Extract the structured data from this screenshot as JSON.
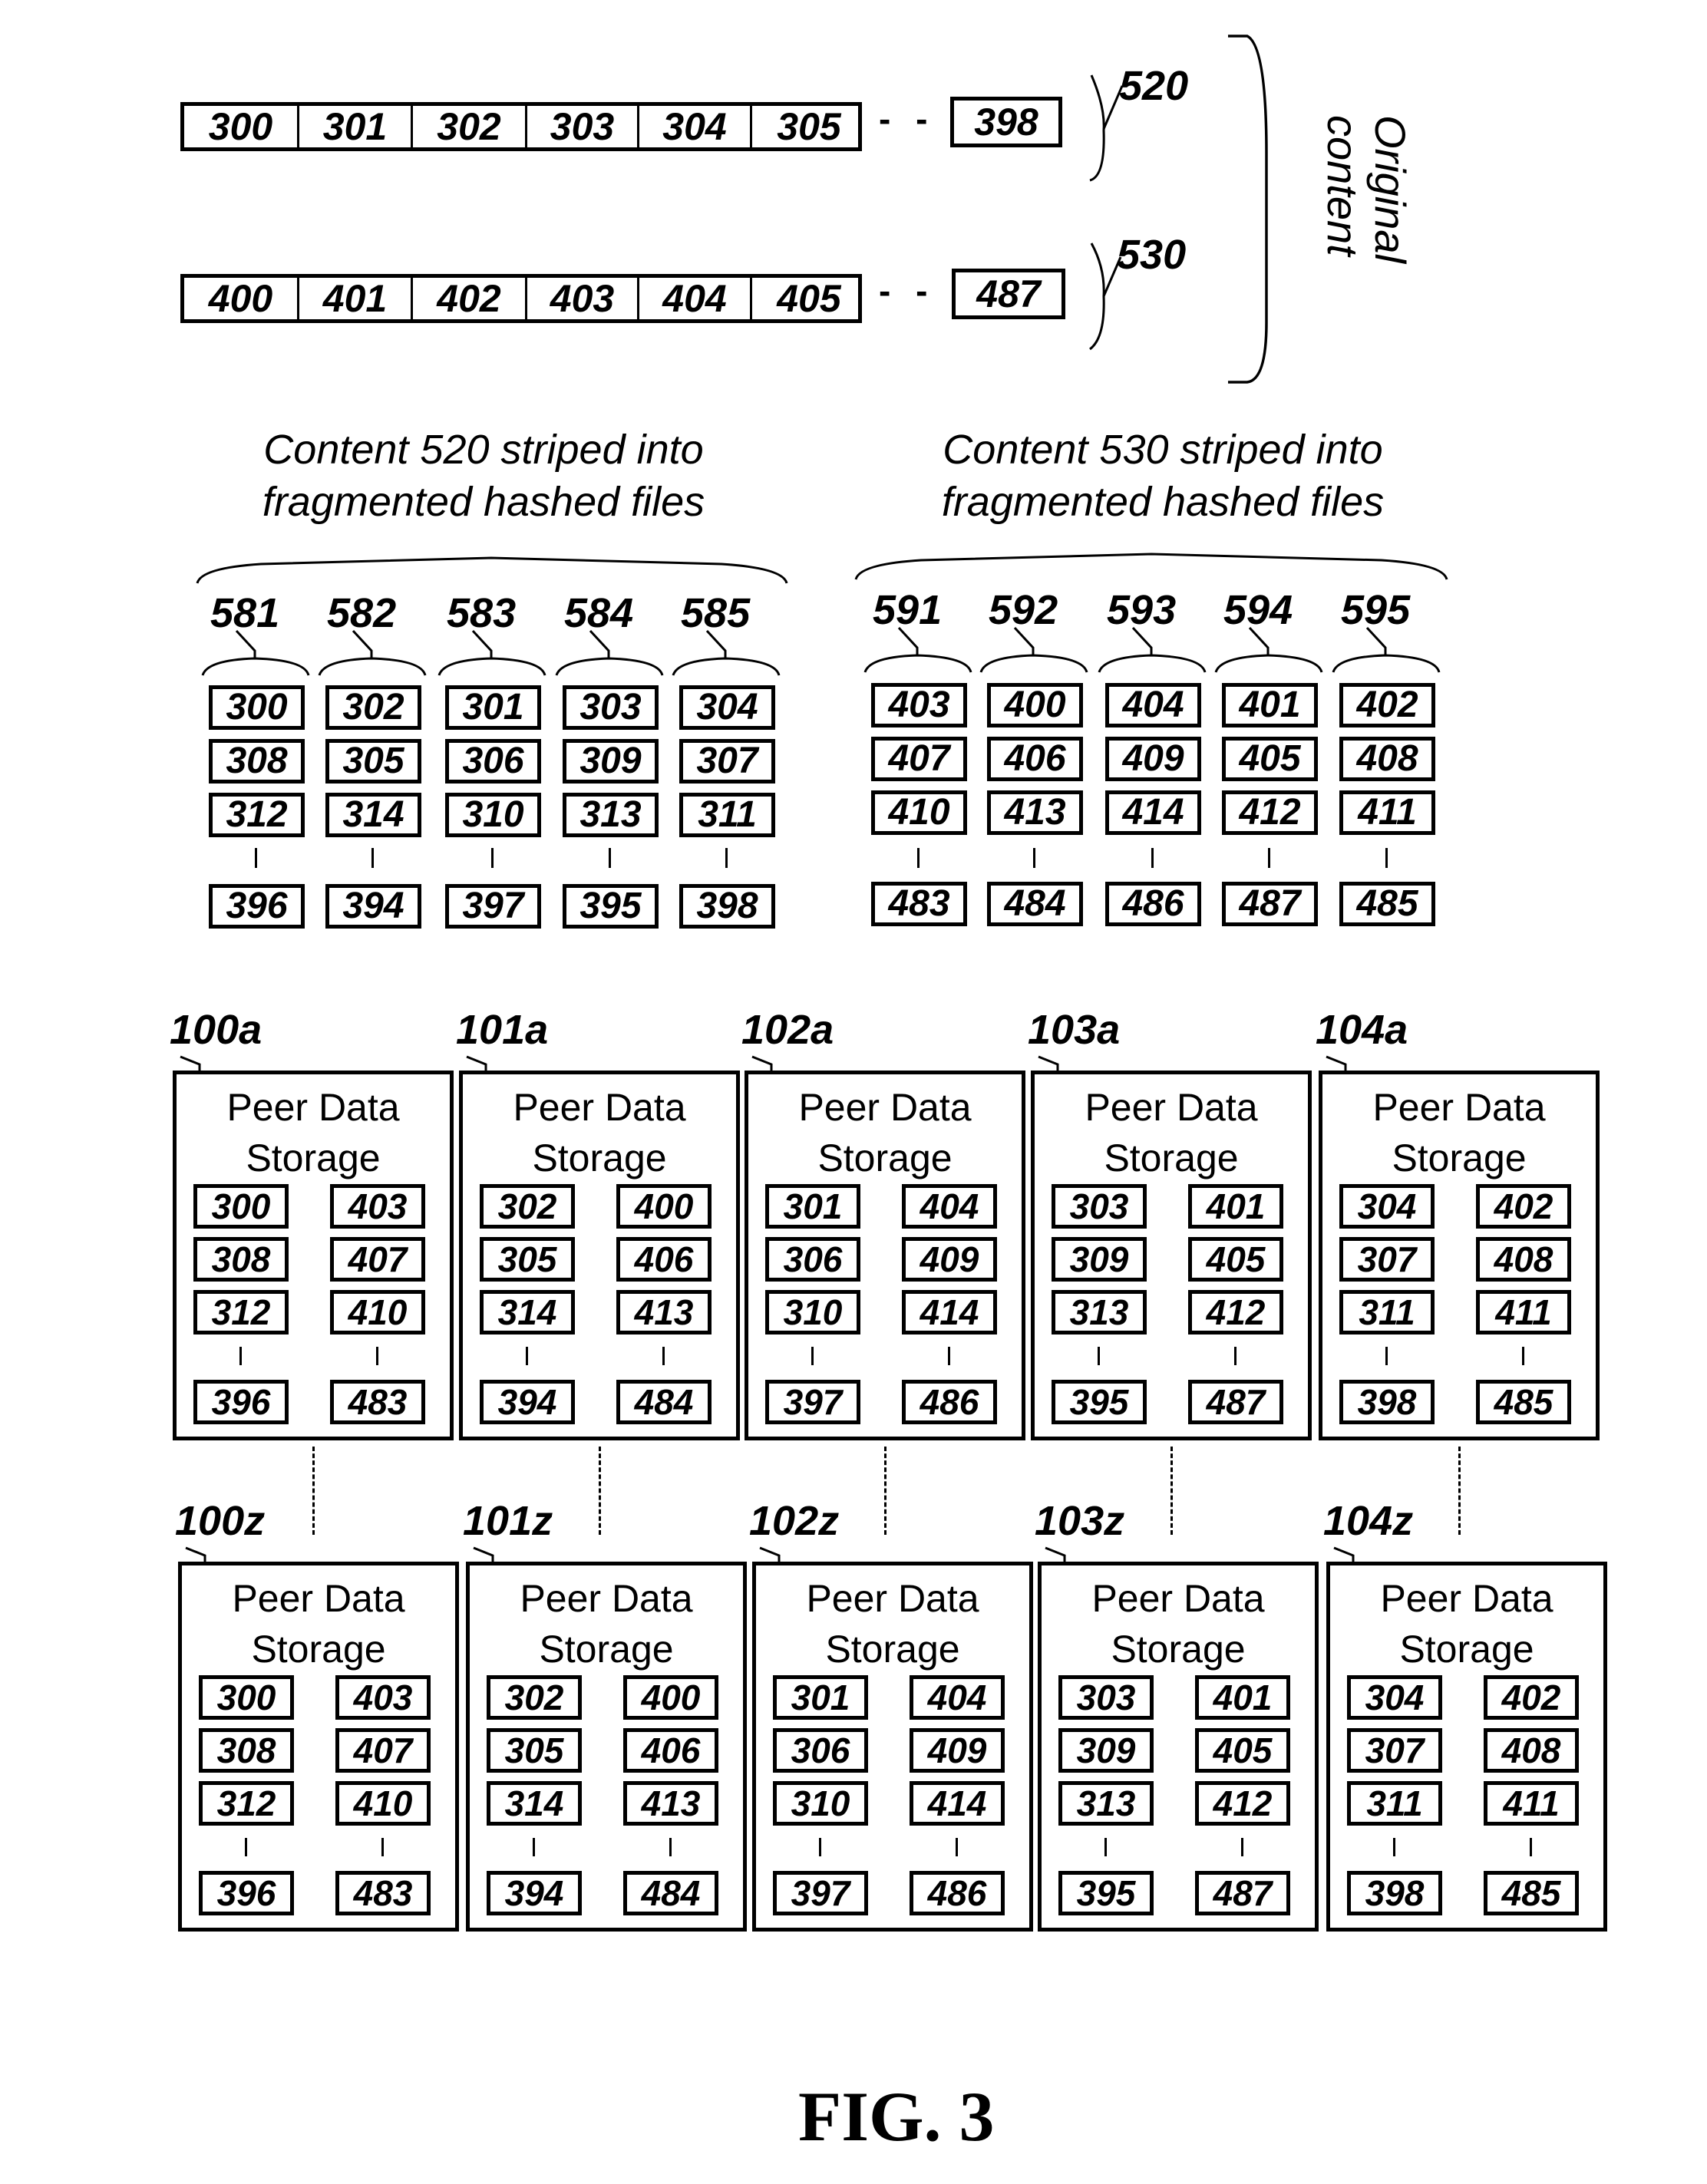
{
  "original_content": {
    "label": "Original content",
    "sequences": [
      {
        "ref": "520",
        "cells": [
          "300",
          "301",
          "302",
          "303",
          "304",
          "305"
        ],
        "ellipsis": "- -",
        "last": "398"
      },
      {
        "ref": "530",
        "cells": [
          "400",
          "401",
          "402",
          "403",
          "404",
          "405"
        ],
        "ellipsis": "- -",
        "last": "487"
      }
    ]
  },
  "striping": [
    {
      "caption": "Content 520 striped into fragmented hashed files",
      "files": [
        {
          "ref": "581",
          "fragments": [
            "300",
            "308",
            "312"
          ],
          "last": "396"
        },
        {
          "ref": "582",
          "fragments": [
            "302",
            "305",
            "314"
          ],
          "last": "394"
        },
        {
          "ref": "583",
          "fragments": [
            "301",
            "306",
            "310"
          ],
          "last": "397"
        },
        {
          "ref": "584",
          "fragments": [
            "303",
            "309",
            "313"
          ],
          "last": "395"
        },
        {
          "ref": "585",
          "fragments": [
            "304",
            "307",
            "311"
          ],
          "last": "398"
        }
      ]
    },
    {
      "caption": "Content 530 striped into fragmented hashed files",
      "files": [
        {
          "ref": "591",
          "fragments": [
            "403",
            "407",
            "410"
          ],
          "last": "483"
        },
        {
          "ref": "592",
          "fragments": [
            "400",
            "406",
            "413"
          ],
          "last": "484"
        },
        {
          "ref": "593",
          "fragments": [
            "404",
            "409",
            "414"
          ],
          "last": "486"
        },
        {
          "ref": "594",
          "fragments": [
            "401",
            "405",
            "412"
          ],
          "last": "487"
        },
        {
          "ref": "595",
          "fragments": [
            "402",
            "408",
            "411"
          ],
          "last": "485"
        }
      ]
    }
  ],
  "peer_title": "Peer Data Storage",
  "peer_rows": [
    {
      "peers": [
        {
          "ref": "100a",
          "col1": [
            "300",
            "308",
            "312"
          ],
          "col1_last": "396",
          "col2": [
            "403",
            "407",
            "410"
          ],
          "col2_last": "483"
        },
        {
          "ref": "101a",
          "col1": [
            "302",
            "305",
            "314"
          ],
          "col1_last": "394",
          "col2": [
            "400",
            "406",
            "413"
          ],
          "col2_last": "484"
        },
        {
          "ref": "102a",
          "col1": [
            "301",
            "306",
            "310"
          ],
          "col1_last": "397",
          "col2": [
            "404",
            "409",
            "414"
          ],
          "col2_last": "486"
        },
        {
          "ref": "103a",
          "col1": [
            "303",
            "309",
            "313"
          ],
          "col1_last": "395",
          "col2": [
            "401",
            "405",
            "412"
          ],
          "col2_last": "487"
        },
        {
          "ref": "104a",
          "col1": [
            "304",
            "307",
            "311"
          ],
          "col1_last": "398",
          "col2": [
            "402",
            "408",
            "411"
          ],
          "col2_last": "485"
        }
      ]
    },
    {
      "peers": [
        {
          "ref": "100z",
          "col1": [
            "300",
            "308",
            "312"
          ],
          "col1_last": "396",
          "col2": [
            "403",
            "407",
            "410"
          ],
          "col2_last": "483"
        },
        {
          "ref": "101z",
          "col1": [
            "302",
            "305",
            "314"
          ],
          "col1_last": "394",
          "col2": [
            "400",
            "406",
            "413"
          ],
          "col2_last": "484"
        },
        {
          "ref": "102z",
          "col1": [
            "301",
            "306",
            "310"
          ],
          "col1_last": "397",
          "col2": [
            "404",
            "409",
            "414"
          ],
          "col2_last": "486"
        },
        {
          "ref": "103z",
          "col1": [
            "303",
            "309",
            "313"
          ],
          "col1_last": "395",
          "col2": [
            "401",
            "405",
            "412"
          ],
          "col2_last": "487"
        },
        {
          "ref": "104z",
          "col1": [
            "304",
            "307",
            "311"
          ],
          "col1_last": "398",
          "col2": [
            "402",
            "408",
            "411"
          ],
          "col2_last": "485"
        }
      ]
    }
  ],
  "figure_label": "FIG. 3"
}
